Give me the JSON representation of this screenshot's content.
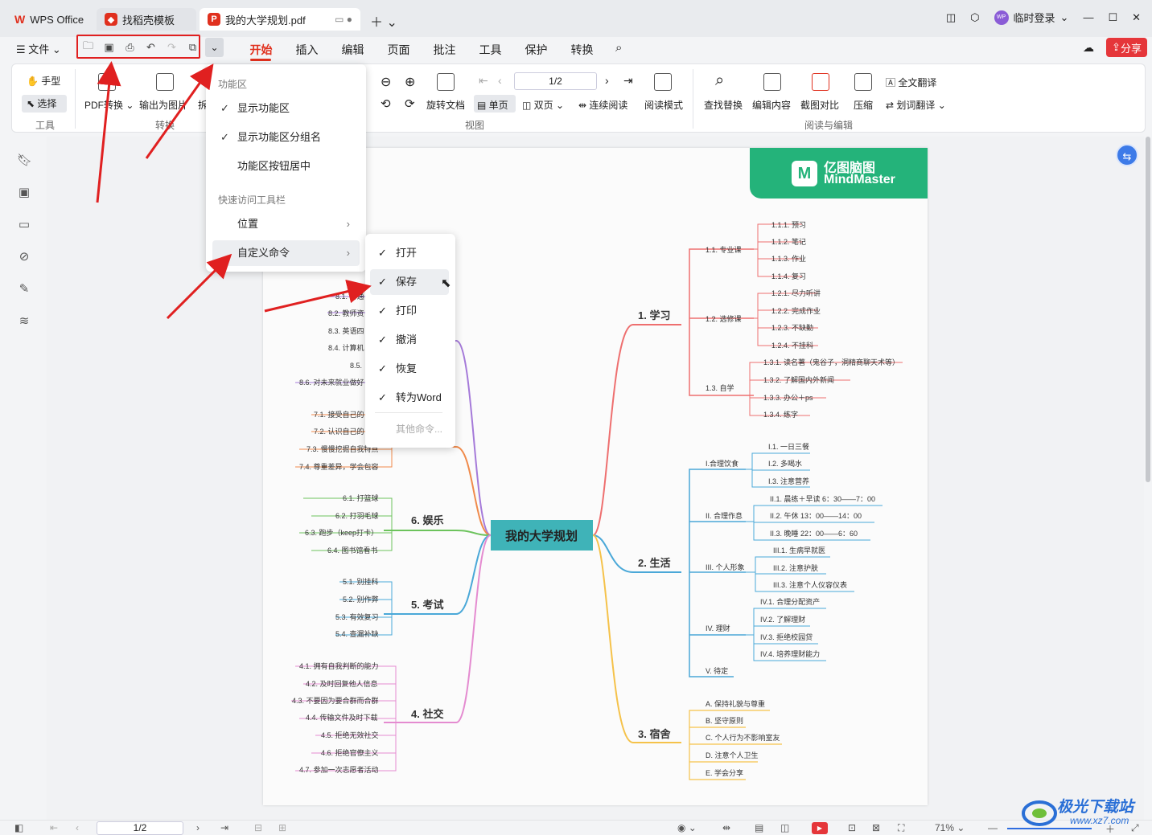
{
  "titlebar": {
    "tabs": [
      {
        "label": "WPS Office"
      },
      {
        "label": "找稻壳模板"
      },
      {
        "label": "我的大学规划.pdf"
      }
    ],
    "user": "临时登录",
    "avatar": "WP"
  },
  "menubar": {
    "file": "文件",
    "tabs": [
      "开始",
      "插入",
      "编辑",
      "页面",
      "批注",
      "工具",
      "保护",
      "转换"
    ],
    "active_tab": "开始",
    "share": "分享"
  },
  "ribbon": {
    "hand": "手型",
    "select": "选择",
    "group_tools": "工具",
    "pdf_convert": "PDF转换",
    "export_image": "输出为图片",
    "convert_partial": "拆",
    "group_convert": "转换",
    "page_value": "1/2",
    "rotate": "旋转文档",
    "single_page": "单页",
    "double_page": "双页",
    "continuous": "连续阅读",
    "read_mode": "阅读模式",
    "group_view": "视图",
    "find_replace": "查找替换",
    "edit_content": "编辑内容",
    "screenshot_compare": "截图对比",
    "compress": "压缩",
    "full_translate": "全文翻译",
    "word_translate": "划词翻译",
    "group_read_edit": "阅读与编辑"
  },
  "dropdown": {
    "section1": "功能区",
    "items1": [
      "显示功能区",
      "显示功能区分组名",
      "功能区按钮居中"
    ],
    "section2": "快速访问工具栏",
    "position": "位置",
    "custom": "自定义命令"
  },
  "submenu": {
    "items": [
      "打开",
      "保存",
      "打印",
      "撤消",
      "恢复",
      "转为Word"
    ],
    "more": "其他命令..."
  },
  "mindmap": {
    "brand_cn": "亿图脑图",
    "brand_en": "MindMaster",
    "center": "我的大学规划",
    "branches": {
      "study": "1. 学习",
      "life": "2. 生活",
      "dorm": "3. 宿舍",
      "social": "4. 社交",
      "exam": "5. 考试",
      "fun": "6. 娱乐"
    },
    "study_sub": [
      "1.1. 专业课",
      "1.2. 选修课",
      "1.3. 自学"
    ],
    "study_leaf": [
      "1.1.1. 预习",
      "1.1.2. 笔记",
      "1.1.3. 作业",
      "1.1.4. 复习",
      "1.2.1. 尽力听讲",
      "1.2.2. 完成作业",
      "1.2.3. 不缺勤",
      "1.2.4. 不挂科",
      "1.3.1. 读名著（鬼谷子，洞精商聊天术等）",
      "1.3.2. 了解国内外新闻",
      "1.3.3. 办公＋ps",
      "1.3.4. 练字"
    ],
    "life_sub": [
      "I.合理饮食",
      "II. 合理作息",
      "III. 个人形象",
      "IV. 理财",
      "V. 待定"
    ],
    "life_leaf": [
      "I.1. 一日三餐",
      "I.2. 多喝水",
      "I.3. 注意营养",
      "II.1. 晨练＋早读 6：30——7：00",
      "II.2. 午休 13：00——14：00",
      "II.3. 晚睡 22：00——6：60",
      "III.1. 生病早就医",
      "III.2. 注意护肤",
      "III.3. 注意个人仪容仪表",
      "IV.1. 合理分配资产",
      "IV.2. 了解理财",
      "IV.3. 拒绝校园贷",
      "IV.4. 培养理财能力"
    ],
    "dorm_leaf": [
      "A. 保持礼貌与尊重",
      "B. 坚守原则",
      "C. 个人行为不影响室友",
      "D. 注意个人卫生",
      "E. 学会分享"
    ],
    "social_leaf": [
      "4.1. 拥有自我判断的能力",
      "4.2. 及时回复他人信息",
      "4.3. 不要因为要合群而合群",
      "4.4. 传输文件及时下载",
      "4.5. 拒绝无效社交",
      "4.6. 拒绝官僚主义",
      "4.7. 参加一次志愿者活动"
    ],
    "exam_leaf": [
      "5.1. 别挂科",
      "5.2. 别作弊",
      "5.3. 有效复习",
      "5.4. 查漏补缺"
    ],
    "fun_leaf": [
      "6.1. 打篮球",
      "6.2. 打羽毛球",
      "6.3. 跑步（keep打卡）",
      "6.4. 图书馆看书"
    ],
    "b7_leaf": [
      "7.1. 接受自己的",
      "7.2. 认识自己的",
      "7.3. 慢慢挖掘自我特点",
      "7.4. 尊重差异，学会包容"
    ],
    "b8_leaf": [
      "8.1. 普通",
      "8.2. 教师资",
      "8.3. 英语四",
      "8.4. 计算机",
      "8.5.",
      "8.6. 对未来就业做好"
    ]
  },
  "statusbar": {
    "page": "1/2",
    "zoom": "71%"
  },
  "watermark": {
    "text": "极光下载站",
    "url": "www.xz7.com"
  },
  "colors": {
    "accent": "#e0301e",
    "study": "#ee6f6f",
    "life": "#4aa8d8",
    "dorm": "#f5c24a",
    "social": "#e48bd0",
    "exam": "#4aa8d8",
    "fun": "#6cc35c",
    "b7": "#f08a4b",
    "b8": "#a57ad9",
    "center_bg": "#3fb3b8"
  }
}
